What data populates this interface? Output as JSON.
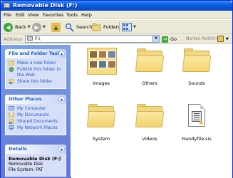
{
  "window": {
    "title": "Removable Disk (F:)"
  },
  "menu": [
    "File",
    "Edit",
    "View",
    "Favorites",
    "Tools",
    "Help"
  ],
  "toolbar": {
    "back_label": "Back",
    "search_label": "Search",
    "folders_label": "Folders"
  },
  "address": {
    "label": "Address",
    "value": "F:\\",
    "go_label": "Go",
    "antivirus_label": "Norton AntiVirus"
  },
  "tasks_panel": {
    "title": "File and Folder Tasks",
    "items": [
      "Make a new folder",
      "Publish this folder to the Web",
      "Share this folder"
    ]
  },
  "places_panel": {
    "title": "Other Places",
    "items": [
      "My Computer",
      "My Documents",
      "Shared Documents",
      "My Network Places"
    ]
  },
  "details_panel": {
    "title": "Details",
    "name": "Removable Disk (F:)",
    "type": "Removable Disk",
    "filesystem": "File System: FAT"
  },
  "items": [
    {
      "label": "Images",
      "kind": "folder-with-thumbnails"
    },
    {
      "label": "Others",
      "kind": "folder"
    },
    {
      "label": "Sounds",
      "kind": "folder"
    },
    {
      "label": "System",
      "kind": "folder"
    },
    {
      "label": "Videos",
      "kind": "folder"
    },
    {
      "label": "Handyfile.sis",
      "kind": "file"
    }
  ]
}
